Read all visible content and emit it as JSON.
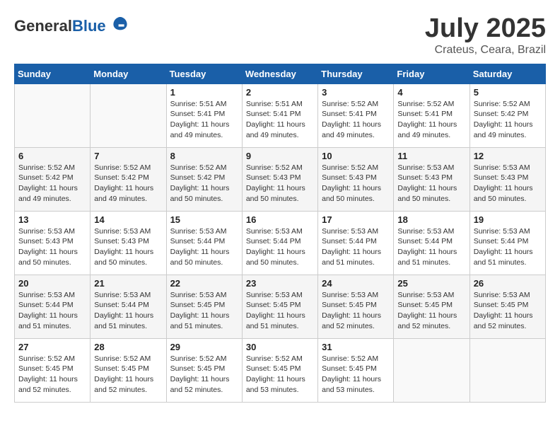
{
  "header": {
    "logo_general": "General",
    "logo_blue": "Blue",
    "month": "July 2025",
    "location": "Crateus, Ceara, Brazil"
  },
  "days_of_week": [
    "Sunday",
    "Monday",
    "Tuesday",
    "Wednesday",
    "Thursday",
    "Friday",
    "Saturday"
  ],
  "weeks": [
    [
      {
        "day": "",
        "info": ""
      },
      {
        "day": "",
        "info": ""
      },
      {
        "day": "1",
        "info": "Sunrise: 5:51 AM\nSunset: 5:41 PM\nDaylight: 11 hours and 49 minutes."
      },
      {
        "day": "2",
        "info": "Sunrise: 5:51 AM\nSunset: 5:41 PM\nDaylight: 11 hours and 49 minutes."
      },
      {
        "day": "3",
        "info": "Sunrise: 5:52 AM\nSunset: 5:41 PM\nDaylight: 11 hours and 49 minutes."
      },
      {
        "day": "4",
        "info": "Sunrise: 5:52 AM\nSunset: 5:41 PM\nDaylight: 11 hours and 49 minutes."
      },
      {
        "day": "5",
        "info": "Sunrise: 5:52 AM\nSunset: 5:42 PM\nDaylight: 11 hours and 49 minutes."
      }
    ],
    [
      {
        "day": "6",
        "info": "Sunrise: 5:52 AM\nSunset: 5:42 PM\nDaylight: 11 hours and 49 minutes."
      },
      {
        "day": "7",
        "info": "Sunrise: 5:52 AM\nSunset: 5:42 PM\nDaylight: 11 hours and 49 minutes."
      },
      {
        "day": "8",
        "info": "Sunrise: 5:52 AM\nSunset: 5:42 PM\nDaylight: 11 hours and 50 minutes."
      },
      {
        "day": "9",
        "info": "Sunrise: 5:52 AM\nSunset: 5:43 PM\nDaylight: 11 hours and 50 minutes."
      },
      {
        "day": "10",
        "info": "Sunrise: 5:52 AM\nSunset: 5:43 PM\nDaylight: 11 hours and 50 minutes."
      },
      {
        "day": "11",
        "info": "Sunrise: 5:53 AM\nSunset: 5:43 PM\nDaylight: 11 hours and 50 minutes."
      },
      {
        "day": "12",
        "info": "Sunrise: 5:53 AM\nSunset: 5:43 PM\nDaylight: 11 hours and 50 minutes."
      }
    ],
    [
      {
        "day": "13",
        "info": "Sunrise: 5:53 AM\nSunset: 5:43 PM\nDaylight: 11 hours and 50 minutes."
      },
      {
        "day": "14",
        "info": "Sunrise: 5:53 AM\nSunset: 5:43 PM\nDaylight: 11 hours and 50 minutes."
      },
      {
        "day": "15",
        "info": "Sunrise: 5:53 AM\nSunset: 5:44 PM\nDaylight: 11 hours and 50 minutes."
      },
      {
        "day": "16",
        "info": "Sunrise: 5:53 AM\nSunset: 5:44 PM\nDaylight: 11 hours and 50 minutes."
      },
      {
        "day": "17",
        "info": "Sunrise: 5:53 AM\nSunset: 5:44 PM\nDaylight: 11 hours and 51 minutes."
      },
      {
        "day": "18",
        "info": "Sunrise: 5:53 AM\nSunset: 5:44 PM\nDaylight: 11 hours and 51 minutes."
      },
      {
        "day": "19",
        "info": "Sunrise: 5:53 AM\nSunset: 5:44 PM\nDaylight: 11 hours and 51 minutes."
      }
    ],
    [
      {
        "day": "20",
        "info": "Sunrise: 5:53 AM\nSunset: 5:44 PM\nDaylight: 11 hours and 51 minutes."
      },
      {
        "day": "21",
        "info": "Sunrise: 5:53 AM\nSunset: 5:44 PM\nDaylight: 11 hours and 51 minutes."
      },
      {
        "day": "22",
        "info": "Sunrise: 5:53 AM\nSunset: 5:45 PM\nDaylight: 11 hours and 51 minutes."
      },
      {
        "day": "23",
        "info": "Sunrise: 5:53 AM\nSunset: 5:45 PM\nDaylight: 11 hours and 51 minutes."
      },
      {
        "day": "24",
        "info": "Sunrise: 5:53 AM\nSunset: 5:45 PM\nDaylight: 11 hours and 52 minutes."
      },
      {
        "day": "25",
        "info": "Sunrise: 5:53 AM\nSunset: 5:45 PM\nDaylight: 11 hours and 52 minutes."
      },
      {
        "day": "26",
        "info": "Sunrise: 5:53 AM\nSunset: 5:45 PM\nDaylight: 11 hours and 52 minutes."
      }
    ],
    [
      {
        "day": "27",
        "info": "Sunrise: 5:52 AM\nSunset: 5:45 PM\nDaylight: 11 hours and 52 minutes."
      },
      {
        "day": "28",
        "info": "Sunrise: 5:52 AM\nSunset: 5:45 PM\nDaylight: 11 hours and 52 minutes."
      },
      {
        "day": "29",
        "info": "Sunrise: 5:52 AM\nSunset: 5:45 PM\nDaylight: 11 hours and 52 minutes."
      },
      {
        "day": "30",
        "info": "Sunrise: 5:52 AM\nSunset: 5:45 PM\nDaylight: 11 hours and 53 minutes."
      },
      {
        "day": "31",
        "info": "Sunrise: 5:52 AM\nSunset: 5:45 PM\nDaylight: 11 hours and 53 minutes."
      },
      {
        "day": "",
        "info": ""
      },
      {
        "day": "",
        "info": ""
      }
    ]
  ]
}
